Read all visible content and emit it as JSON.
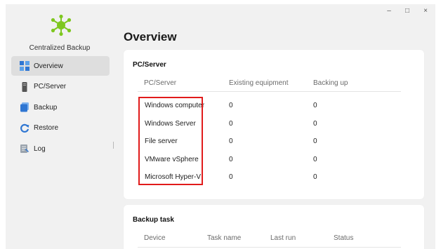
{
  "window": {
    "controls": {
      "minimize": "–",
      "maximize": "□",
      "close": "×"
    }
  },
  "sidebar": {
    "app_title": "Centralized Backup",
    "logo_icon": "network-hub-icon",
    "items": [
      {
        "label": "Overview",
        "icon": "overview-grid-icon",
        "active": true
      },
      {
        "label": "PC/Server",
        "icon": "server-tower-icon",
        "active": false
      },
      {
        "label": "Backup",
        "icon": "backup-stack-icon",
        "active": false
      },
      {
        "label": "Restore",
        "icon": "restore-arrow-icon",
        "active": false
      },
      {
        "label": "Log",
        "icon": "log-document-icon",
        "active": false
      }
    ]
  },
  "main": {
    "title": "Overview",
    "pc_card": {
      "heading": "PC/Server",
      "columns": [
        "PC/Server",
        "Existing equipment",
        "Backing up"
      ],
      "rows": [
        {
          "name": "Windows computer",
          "existing": "0",
          "backing": "0"
        },
        {
          "name": "Windows Server",
          "existing": "0",
          "backing": "0"
        },
        {
          "name": "File server",
          "existing": "0",
          "backing": "0"
        },
        {
          "name": "VMware vSphere",
          "existing": "0",
          "backing": "0"
        },
        {
          "name": "Microsoft Hyper-V",
          "existing": "0",
          "backing": "0"
        }
      ],
      "highlight_color": "#e11b1b"
    },
    "task_card": {
      "heading": "Backup task",
      "columns": [
        "Device",
        "Task name",
        "Last run",
        "Status"
      ]
    }
  },
  "colors": {
    "accent_green": "#7ec71f",
    "nav_blue": "#2f76d2",
    "active_nav_bg": "#dedede"
  }
}
